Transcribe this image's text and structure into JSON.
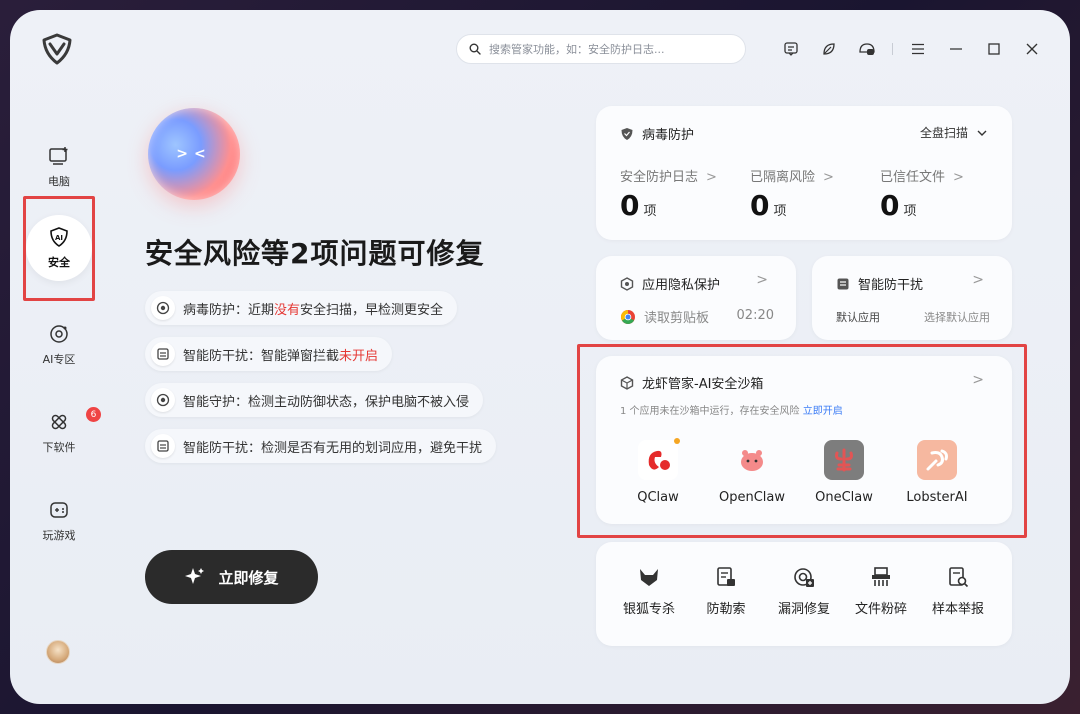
{
  "search": {
    "placeholder": "搜索管家功能，如：安全防护日志..."
  },
  "sidebar": {
    "items": [
      {
        "label": "电脑"
      },
      {
        "label": "安全"
      },
      {
        "label": "AI专区"
      },
      {
        "label": "下软件",
        "badge": "6"
      },
      {
        "label": "玩游戏"
      }
    ]
  },
  "hero": {
    "headline": "安全风险等2项问题可修复",
    "issues": [
      {
        "prefix": "病毒防护：近期",
        "highlight": "没有",
        "suffix": "安全扫描，早检测更安全"
      },
      {
        "prefix": "智能防干扰：智能弹窗拦截",
        "highlight": "未开启",
        "suffix": ""
      },
      {
        "prefix": "智能守护：检测主动防御状态，保护电脑不被入侵",
        "highlight": "",
        "suffix": ""
      },
      {
        "prefix": "智能防干扰：检测是否有无用的划词应用，避免干扰",
        "highlight": "",
        "suffix": ""
      }
    ],
    "fix_button": "立即修复"
  },
  "virus": {
    "title": "病毒防护",
    "scan": "全盘扫描",
    "stats": [
      {
        "label": "安全防护日志",
        "value": "0",
        "unit": "项"
      },
      {
        "label": "已隔离风险",
        "value": "0",
        "unit": "项"
      },
      {
        "label": "已信任文件",
        "value": "0",
        "unit": "项"
      }
    ]
  },
  "privacy": {
    "title": "应用隐私保护",
    "item": "读取剪贴板",
    "time": "02:20"
  },
  "anti": {
    "title": "智能防干扰",
    "left": "默认应用",
    "right": "选择默认应用"
  },
  "sandbox": {
    "title": "龙虾管家-AI安全沙箱",
    "desc": "1 个应用未在沙箱中运行，存在安全风险",
    "link": "立即开启",
    "apps": [
      {
        "name": "QClaw"
      },
      {
        "name": "OpenClaw"
      },
      {
        "name": "OneClaw"
      },
      {
        "name": "LobsterAI"
      }
    ]
  },
  "tools": [
    {
      "name": "银狐专杀"
    },
    {
      "name": "防勒索"
    },
    {
      "name": "漏洞修复"
    },
    {
      "name": "文件粉碎"
    },
    {
      "name": "样本举报"
    }
  ],
  "colors": {
    "accent": "#3b7cf5",
    "alert": "#e53935",
    "dark": "#2b2b2b"
  }
}
